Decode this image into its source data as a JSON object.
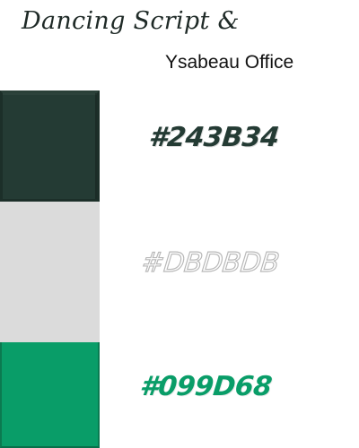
{
  "header": {
    "font_pair_script": "Dancing Script &",
    "font_pair_sans": "Ysabeau Office"
  },
  "palette": [
    {
      "hex": "#243B34",
      "color": "#243B34",
      "label_color": "#243B34"
    },
    {
      "hex": "#DBDBDB",
      "color": "#DBDBDB",
      "label_color": "#DBDBDB"
    },
    {
      "hex": "#099D68",
      "color": "#099D68",
      "label_color": "#099D68"
    }
  ]
}
